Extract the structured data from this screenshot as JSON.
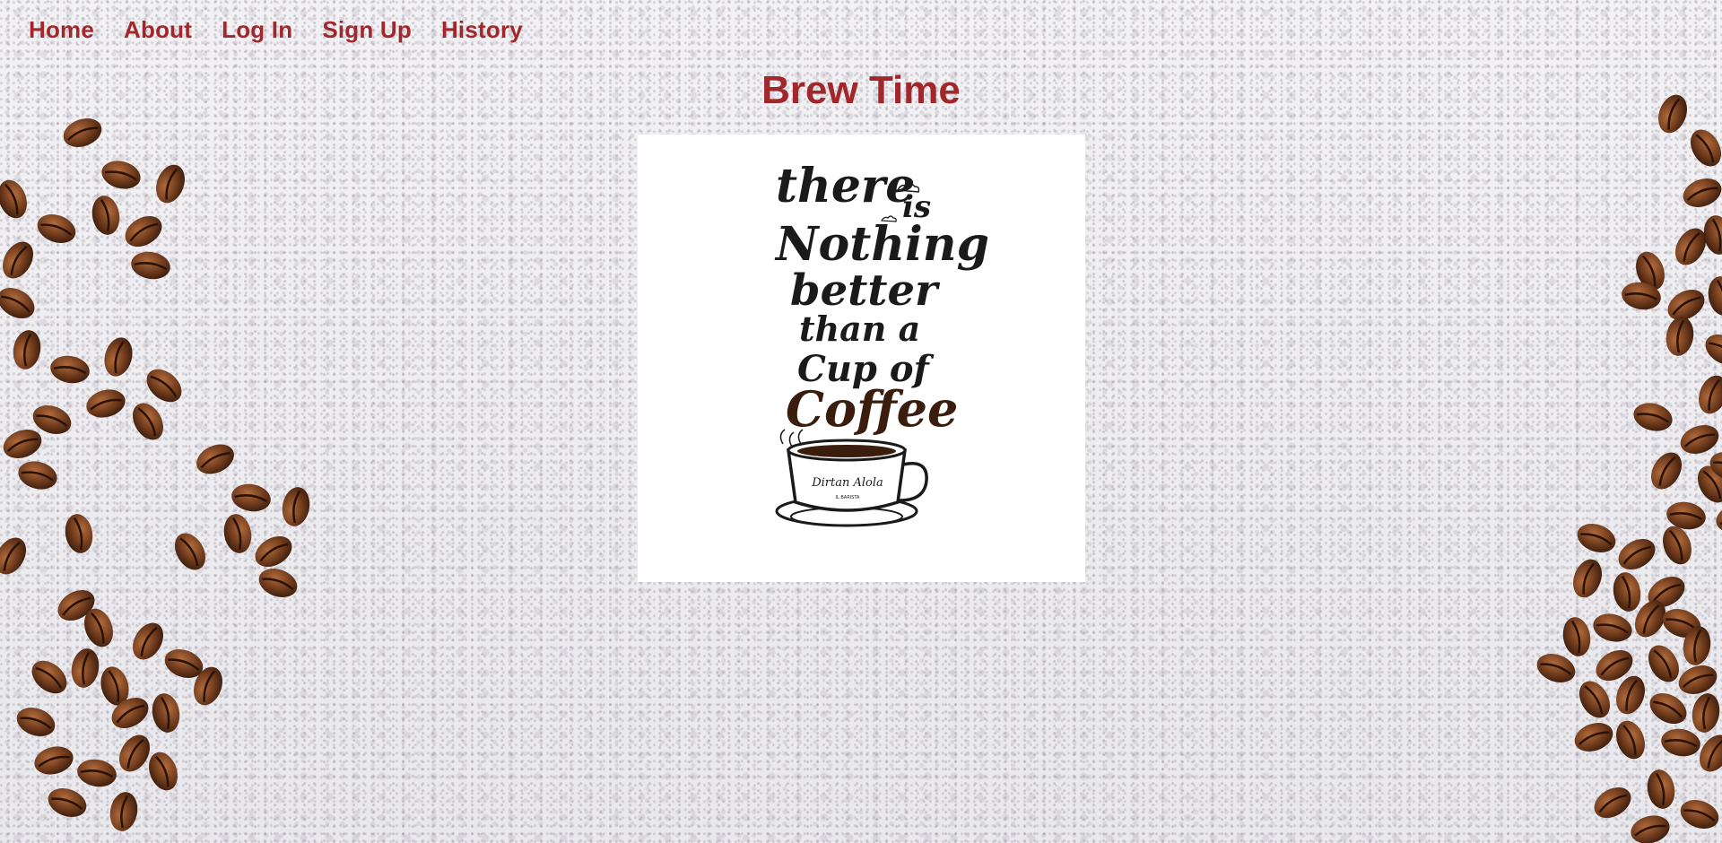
{
  "nav": {
    "items": [
      "Home",
      "About",
      "Log In",
      "Sign Up",
      "History"
    ]
  },
  "page": {
    "title": "Brew Time"
  },
  "poster": {
    "lines": [
      "there",
      "is",
      "Nothing",
      "better",
      "than a",
      "Cup of",
      "Coffee"
    ],
    "cup_label": "Dirtan Alola",
    "cup_sublabel": "IL BARISTA"
  },
  "colors": {
    "accent": "#a1272b",
    "coffee": "#3a1d0c",
    "ink": "#1a1a1a"
  },
  "icons": [
    "coffee-beans-left",
    "coffee-beans-right",
    "coffee-cup-icon"
  ]
}
